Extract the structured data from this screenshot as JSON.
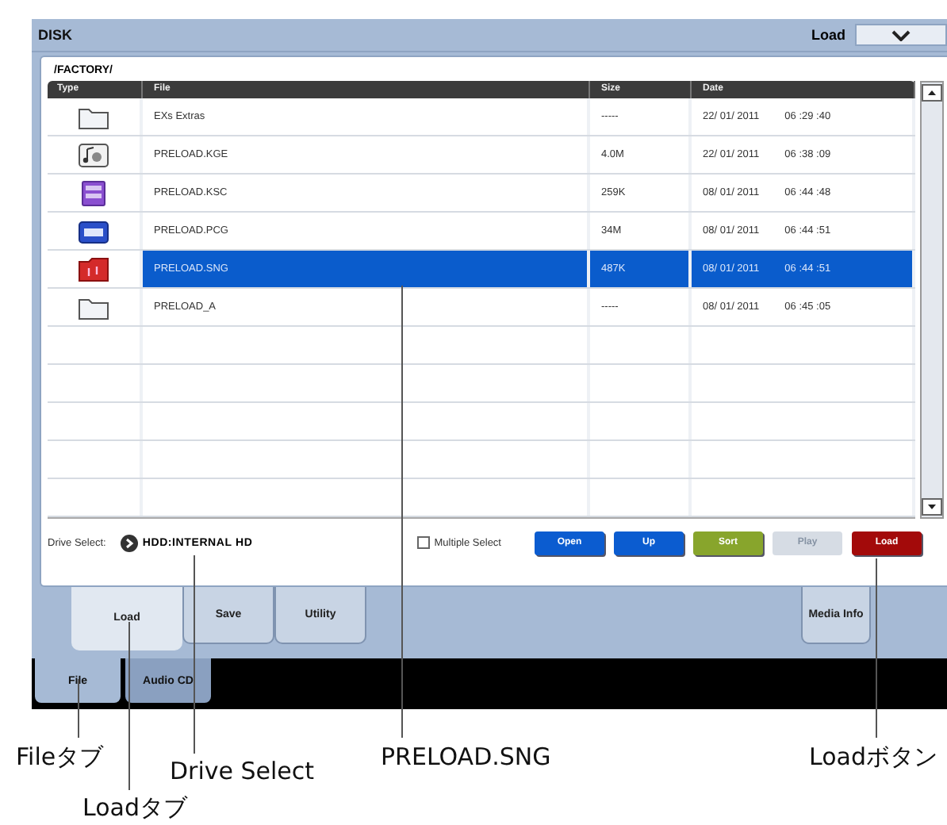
{
  "window": {
    "title": "DISK",
    "mode": "Load"
  },
  "path": "/FACTORY/",
  "table": {
    "columns": [
      "Type",
      "File",
      "Size",
      "Date"
    ],
    "rows": [
      {
        "kind": "folder",
        "file": "EXs Extras",
        "size": "-----",
        "date": "22/ 01/ 2011",
        "time": "06 :29 :40",
        "selected": false
      },
      {
        "kind": "kge",
        "file": "PRELOAD.KGE",
        "size": "4.0M",
        "date": "22/ 01/ 2011",
        "time": "06 :38 :09",
        "selected": false
      },
      {
        "kind": "ksc",
        "file": "PRELOAD.KSC",
        "size": "259K",
        "date": "08/ 01/ 2011",
        "time": "06 :44 :48",
        "selected": false
      },
      {
        "kind": "pcg",
        "file": "PRELOAD.PCG",
        "size": "34M",
        "date": "08/ 01/ 2011",
        "time": "06 :44 :51",
        "selected": false
      },
      {
        "kind": "sng",
        "file": "PRELOAD.SNG",
        "size": "487K",
        "date": "08/ 01/ 2011",
        "time": "06 :44 :51",
        "selected": true
      },
      {
        "kind": "folder",
        "file": "PRELOAD_A",
        "size": "-----",
        "date": "08/ 01/ 2011",
        "time": "06 :45 :05",
        "selected": false
      }
    ]
  },
  "drive": {
    "label": "Drive Select:",
    "value": "HDD:INTERNAL HD"
  },
  "multiple_select": {
    "label": "Multiple Select",
    "checked": false
  },
  "buttons": [
    {
      "label": "Open",
      "color": "#0b5cd0",
      "disabled": false
    },
    {
      "label": "Up",
      "color": "#0b5cd0",
      "disabled": false
    },
    {
      "label": "Sort",
      "color": "#88a52c",
      "disabled": false
    },
    {
      "label": "Play",
      "color": "#d6dce4",
      "disabled": true
    },
    {
      "label": "Load",
      "color": "#a30a0a",
      "disabled": false
    }
  ],
  "tabs": [
    {
      "label": "Load",
      "selected": true,
      "right": false
    },
    {
      "label": "Save",
      "selected": false,
      "right": false
    },
    {
      "label": "Utility",
      "selected": false,
      "right": false
    },
    {
      "label": "Media Info",
      "selected": false,
      "right": true
    }
  ],
  "subtabs": [
    {
      "label": "File",
      "selected": true
    },
    {
      "label": "Audio CD",
      "selected": false
    }
  ],
  "annotations": [
    {
      "label": "Fileタブ"
    },
    {
      "label": "Loadタブ"
    },
    {
      "label": "Drive Select"
    },
    {
      "label": "PRELOAD.SNG"
    },
    {
      "label": "Loadボタン"
    }
  ]
}
